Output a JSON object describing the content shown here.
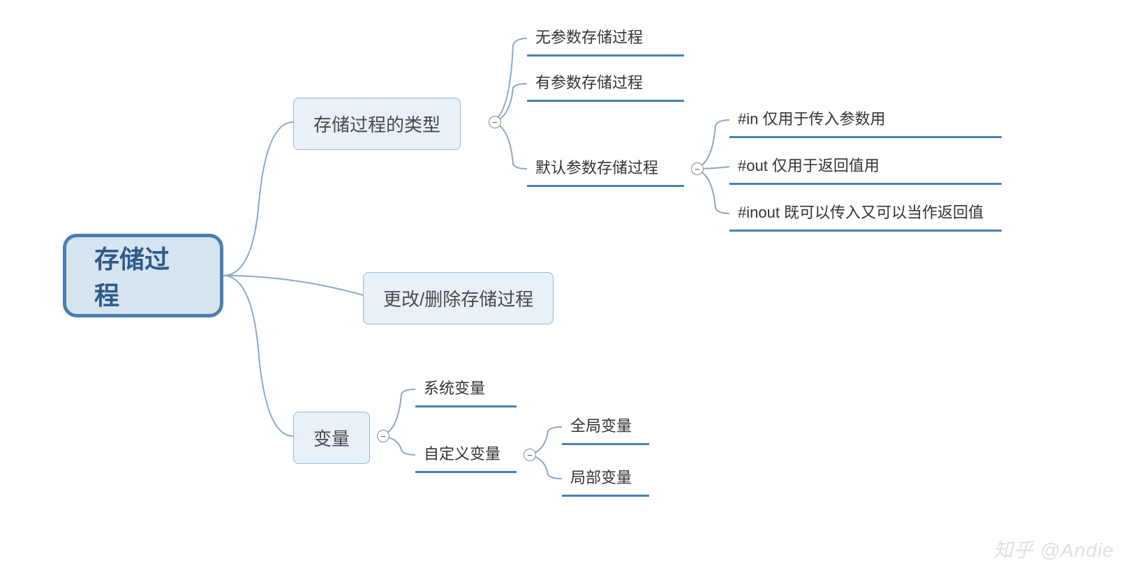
{
  "root": {
    "label": "存储过程"
  },
  "branches": {
    "types": {
      "label": "存储过程的类型",
      "children": {
        "no_param": "无参数存储过程",
        "has_param": "有参数存储过程",
        "default_param": {
          "label": "默认参数存储过程",
          "children": {
            "in": "#in 仅用于传入参数用",
            "out": "#out 仅用于返回值用",
            "inout": "#inout 既可以传入又可以当作返回值"
          }
        }
      }
    },
    "modify_delete": {
      "label": "更改/删除存储过程"
    },
    "variables": {
      "label": "变量",
      "children": {
        "system": "系统变量",
        "custom": {
          "label": "自定义变量",
          "children": {
            "global": "全局变量",
            "local": "局部变量"
          }
        }
      }
    }
  },
  "watermark": "知乎 @Andie",
  "collapse_symbol": "−"
}
